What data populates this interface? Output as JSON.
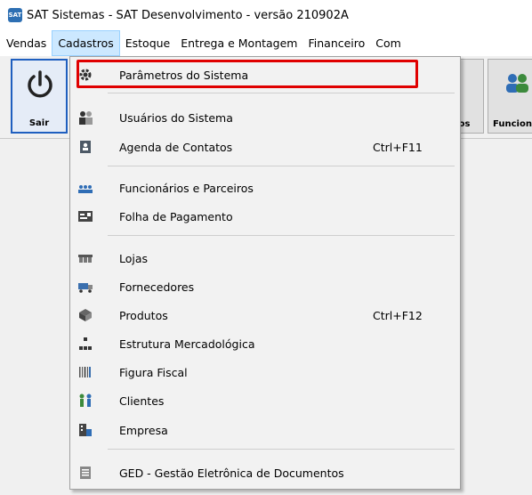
{
  "window": {
    "title": "SAT Sistemas - SAT Desenvolvimento - versão 210902A",
    "icon": "sat-app-icon"
  },
  "menubar": {
    "items": [
      {
        "label": "Vendas"
      },
      {
        "label": "Cadastros",
        "active": true
      },
      {
        "label": "Estoque"
      },
      {
        "label": "Entrega e Montagem"
      },
      {
        "label": "Financeiro"
      },
      {
        "label": "Com"
      }
    ]
  },
  "toolbar": {
    "sair_label": "Sair",
    "partial_label": "os",
    "func_label": "Funcion"
  },
  "dropdown": {
    "items": [
      {
        "label": "Parâmetros do Sistema",
        "icon": "gear-icon",
        "shortcut": ""
      },
      {
        "label": "Usuários do Sistema",
        "icon": "users-icon",
        "shortcut": ""
      },
      {
        "label": "Agenda de Contatos",
        "icon": "contacts-book-icon",
        "shortcut": "Ctrl+F11"
      },
      {
        "label": "Funcionários e Parceiros",
        "icon": "people-group-icon",
        "shortcut": ""
      },
      {
        "label": "Folha de Pagamento",
        "icon": "payroll-icon",
        "shortcut": ""
      },
      {
        "label": "Lojas",
        "icon": "store-icon",
        "shortcut": ""
      },
      {
        "label": "Fornecedores",
        "icon": "truck-icon",
        "shortcut": ""
      },
      {
        "label": "Produtos",
        "icon": "product-box-icon",
        "shortcut": "Ctrl+F12"
      },
      {
        "label": "Estrutura Mercadológica",
        "icon": "hierarchy-icon",
        "shortcut": ""
      },
      {
        "label": "Figura Fiscal",
        "icon": "barcode-icon",
        "shortcut": ""
      },
      {
        "label": "Clientes",
        "icon": "customers-icon",
        "shortcut": ""
      },
      {
        "label": "Empresa",
        "icon": "building-icon",
        "shortcut": ""
      },
      {
        "label": "GED - Gestão Eletrônica de Documentos",
        "icon": "document-icon",
        "shortcut": ""
      }
    ]
  },
  "colors": {
    "highlight": "#e00000",
    "menu_active": "#cce8ff",
    "accent": "#1f5fbf"
  }
}
